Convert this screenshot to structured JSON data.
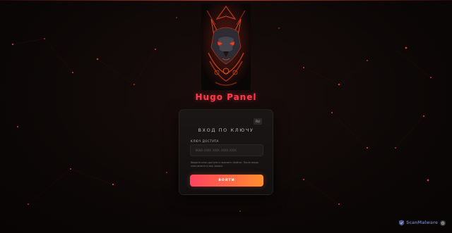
{
  "app": {
    "brand_title": "Hugo Panel"
  },
  "login_card": {
    "lang_label": "RU",
    "title": "ВХОД ПО КЛЮЧУ",
    "key_label": "КЛЮЧ ДОСТУПА",
    "key_placeholder": "HUGO-XXXX-XXXX-XXXX-XXXX",
    "key_value": "",
    "hint": "Введите ключ доступа и нажмите «Войти». После входа ключ вместе в кеш записи.",
    "submit_label": "ВОЙТИ"
  },
  "watermark": {
    "text": "ScanMalware",
    "icon": "scanmalware-logo-icon"
  },
  "colors": {
    "accent_start": "#ff4360",
    "accent_end": "#ff8f2e",
    "brand_title": "#ff3b4e",
    "background": "#0d0807"
  }
}
